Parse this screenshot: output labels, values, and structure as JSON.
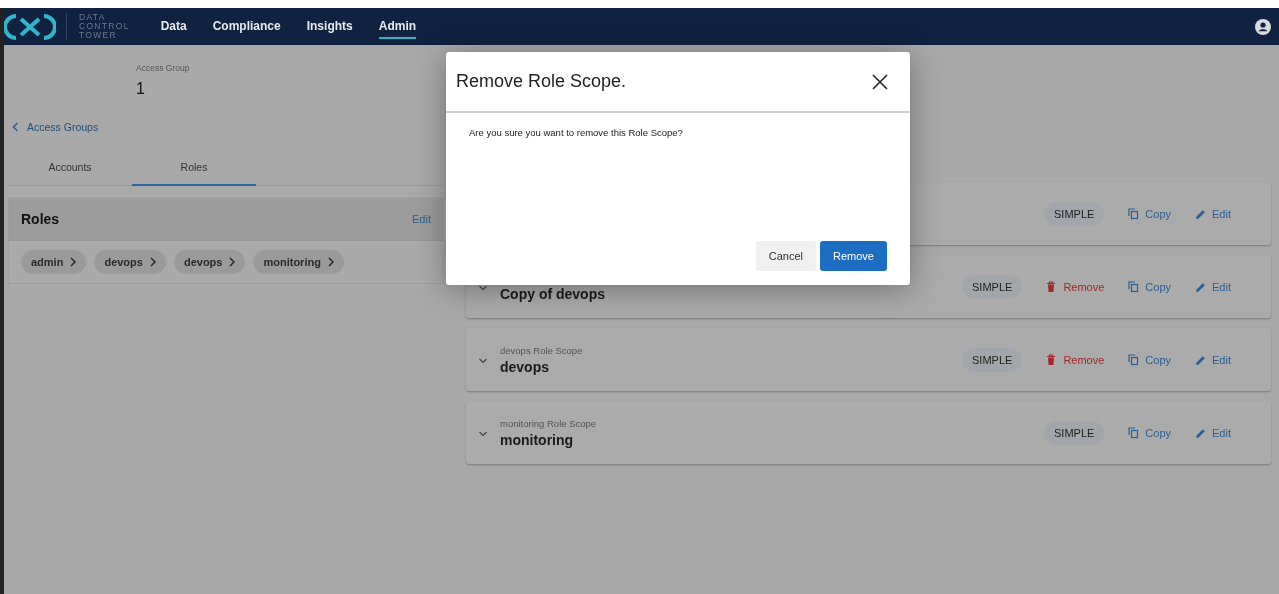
{
  "navbar": {
    "logo_text": [
      "DATA",
      "CONTROL",
      "TOWER"
    ],
    "items": [
      {
        "label": "Data",
        "selected": false
      },
      {
        "label": "Compliance",
        "selected": false
      },
      {
        "label": "Insights",
        "selected": false
      },
      {
        "label": "Admin",
        "selected": true
      }
    ]
  },
  "header": {
    "back_link": "Access Groups",
    "label": "Access Group",
    "value": "1"
  },
  "tabs": [
    {
      "label": "Accounts",
      "selected": false
    },
    {
      "label": "Roles",
      "selected": true
    }
  ],
  "roles_panel": {
    "title": "Roles",
    "edit": "Edit",
    "chips": [
      "admin",
      "devops",
      "devops",
      "monitoring"
    ]
  },
  "scopes": [
    {
      "badge": "SIMPLE",
      "actions": [
        {
          "kind": "copy",
          "label": "Copy"
        },
        {
          "kind": "edit",
          "label": "Edit"
        }
      ]
    },
    {
      "title": "Copy of devops",
      "badge": "SIMPLE",
      "actions": [
        {
          "kind": "remove",
          "label": "Remove"
        },
        {
          "kind": "copy",
          "label": "Copy"
        },
        {
          "kind": "edit",
          "label": "Edit"
        }
      ]
    },
    {
      "subtitle": "devops Role Scope",
      "title": "devops",
      "badge": "SIMPLE",
      "actions": [
        {
          "kind": "remove",
          "label": "Remove"
        },
        {
          "kind": "copy",
          "label": "Copy"
        },
        {
          "kind": "edit",
          "label": "Edit"
        }
      ]
    },
    {
      "subtitle": "monitoring Role Scope",
      "title": "monitoring",
      "badge": "SIMPLE",
      "actions": [
        {
          "kind": "copy",
          "label": "Copy"
        },
        {
          "kind": "edit",
          "label": "Edit"
        }
      ]
    }
  ],
  "dialog": {
    "title": "Remove Role Scope.",
    "message": "Are you sure you want to remove this Role Scope?",
    "buttons": [
      {
        "kind": "secondary",
        "label": "Cancel"
      },
      {
        "kind": "primary",
        "label": "Remove"
      }
    ]
  }
}
